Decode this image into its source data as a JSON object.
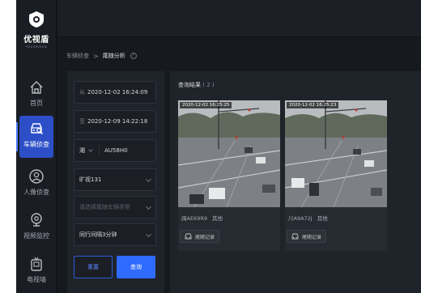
{
  "app": {
    "name": "优视盾",
    "sub": "YOUSHIDUN"
  },
  "nav": [
    {
      "label": "首页",
      "icon": "home-icon"
    },
    {
      "label": "车辆侦查",
      "icon": "car-search-icon",
      "active": true
    },
    {
      "label": "人像侦查",
      "icon": "person-search-icon"
    },
    {
      "label": "视频监控",
      "icon": "camera-icon"
    },
    {
      "label": "电视墙",
      "icon": "tv-icon"
    }
  ],
  "breadcrumb": {
    "parent": "车辆侦查",
    "separator": ">",
    "current": "尾随分析"
  },
  "filter": {
    "from_prefix": "从",
    "from_value": "2020-12-02 16:24:09",
    "to_prefix": "至",
    "to_value": "2020-12-09 14:22:18",
    "plate_province": "湘",
    "plate_number": "AU58H0",
    "camera_value": "旷视131",
    "vehicle_type_placeholder": "请选择尾随车辆类型",
    "interval_value": "同行间隔3分钟",
    "reset_label": "重置",
    "query_label": "查询"
  },
  "results": {
    "title": "查询结果",
    "count": "( 2 )",
    "items": [
      {
        "timestamp": "2020-12-02 16:25:25",
        "plate": "闽AE69R9",
        "type": "其他",
        "action": "尾随记录"
      },
      {
        "timestamp": "2020-12-02 16:25:23",
        "plate": "川A9A72J",
        "type": "其他",
        "action": "尾随记录"
      }
    ]
  },
  "colors": {
    "accent": "#2f6bff",
    "nav_active": "#2c4fc7",
    "background": "#16191e",
    "panel": "#1f232a"
  }
}
